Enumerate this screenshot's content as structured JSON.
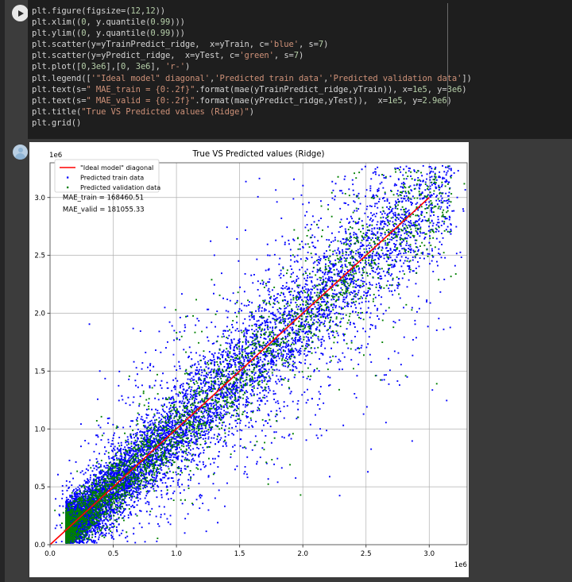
{
  "notebook": {
    "run_button_icon": "play-icon",
    "output_avatar_icon": "user-avatar-icon"
  },
  "code": {
    "lines": [
      "plt.figure(figsize=(12,12))",
      "plt.xlim((0, y.quantile(0.99)))",
      "plt.ylim((0, y.quantile(0.99)))",
      "plt.scatter(y=yTrainPredict_ridge,  x=yTrain, c='blue', s=7)",
      "plt.scatter(y=yPredict_ridge,  x=yTest, c='green', s=7)",
      "plt.plot([0,3e6],[0, 3e6], 'r-')",
      "plt.legend(['\"Ideal model\" diagonal','Predicted train data','Predicted validation data'])",
      "plt.text(s=\" MAE_train = {0:.2f}\".format(mae(yTrainPredict_ridge,yTrain)), x=1e5, y=3e6)",
      "plt.text(s=\" MAE_valid = {0:.2f}\".format(mae(yPredict_ridge,yTest)),  x=1e5, y=2.9e6)",
      "plt.title(\"True VS Predicted values (Ridge)\")",
      "plt.grid()"
    ]
  },
  "chart_data": {
    "type": "scatter",
    "title": "True VS Predicted values (Ridge)",
    "xlabel": "",
    "ylabel": "",
    "xlim": [
      0,
      3.3
    ],
    "ylim": [
      0,
      3.3
    ],
    "x_offset_text": "1e6",
    "y_offset_text": "1e6",
    "xticks": [
      0.0,
      0.5,
      1.0,
      1.5,
      2.0,
      2.5,
      3.0
    ],
    "xticklabels": [
      "0.0",
      "0.5",
      "1.0",
      "1.5",
      "2.0",
      "2.5",
      "3.0"
    ],
    "yticks": [
      0.0,
      0.5,
      1.0,
      1.5,
      2.0,
      2.5,
      3.0
    ],
    "yticklabels": [
      "0.0",
      "0.5",
      "1.0",
      "1.5",
      "2.0",
      "2.5",
      "3.0"
    ],
    "grid": true,
    "legend_position": "upper left",
    "legend": [
      {
        "label": "\"Ideal model\" diagonal",
        "marker": "line",
        "color": "#ff0000"
      },
      {
        "label": "Predicted train data",
        "marker": "dot",
        "color": "#0000ff"
      },
      {
        "label": "Predicted validation data",
        "marker": "dot",
        "color": "#008000"
      }
    ],
    "annotations": [
      {
        "text": " MAE_train = 168460.51",
        "x": 0.1,
        "y": 3.0
      },
      {
        "text": " MAE_valid = 181055.33",
        "x": 0.1,
        "y": 2.9
      }
    ],
    "reference_line": {
      "x": [
        0,
        3.0
      ],
      "y": [
        0,
        3.0
      ],
      "color": "#ff0000",
      "style": "-"
    },
    "series": [
      {
        "name": "Predicted train data",
        "color": "#0000ff",
        "marker_size": 7,
        "n_points": 9000,
        "distribution": "diagonal-cloud",
        "spread": 0.3,
        "tail_fraction": 0.32
      },
      {
        "name": "Predicted validation data",
        "color": "#008000",
        "marker_size": 7,
        "n_points": 3200,
        "distribution": "diagonal-cloud",
        "spread": 0.26,
        "tail_fraction": 0.22
      }
    ]
  }
}
